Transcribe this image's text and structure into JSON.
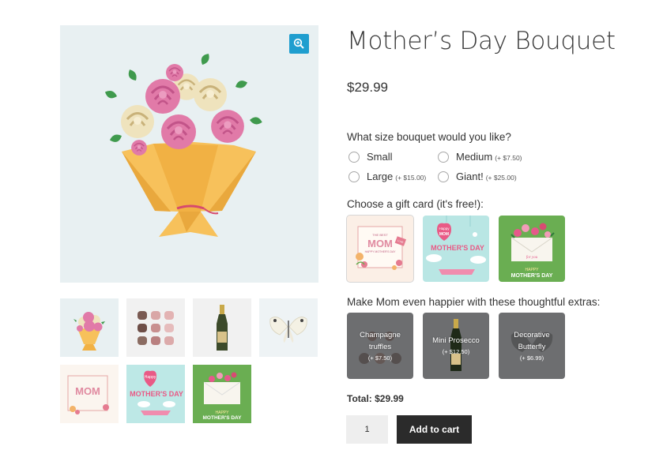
{
  "product": {
    "title": "Mother’s Day Bouquet",
    "price": "$29.99",
    "main_image_icon": "bouquet-illustration",
    "zoom_icon": "magnify-plus-icon"
  },
  "gallery": {
    "thumbnails": [
      {
        "name": "bouquet"
      },
      {
        "name": "chocolate-truffles"
      },
      {
        "name": "prosecco-bottle"
      },
      {
        "name": "butterfly"
      },
      {
        "name": "mom-card"
      },
      {
        "name": "happy-mothers-day-card"
      },
      {
        "name": "envelope-flowers-card"
      }
    ]
  },
  "size_question": {
    "label": "What size bouquet would you like?",
    "options": [
      {
        "label": "Small",
        "addon": ""
      },
      {
        "label": "Medium",
        "addon": "(+ $7.50)"
      },
      {
        "label": "Large",
        "addon": "(+ $15.00)"
      },
      {
        "label": "Giant!",
        "addon": "(+ $25.00)"
      }
    ]
  },
  "gift_card": {
    "label": "Choose a gift card (it's free!):",
    "card1_texts": {
      "small_top": "THE BEST",
      "big": "MOM",
      "small_bottom": "HAPPY MOTHER'S DAY",
      "tag": "LOVE"
    },
    "card2_texts": {
      "happy": "Happy",
      "mom": "MOM",
      "line": "MOTHER'S DAY"
    },
    "card3_texts": {
      "for_you": "for you",
      "line1": "HAPPY",
      "line2": "MOTHER'S DAY"
    }
  },
  "extras": {
    "label": "Make Mom even happier with these thoughtful extras:",
    "items": [
      {
        "name_line1": "Champagne",
        "name_line2": "truffles",
        "cost": "(+ $7.50)"
      },
      {
        "name_line1": "Mini Prosecco",
        "name_line2": "",
        "cost": "(+ $12.50)"
      },
      {
        "name_line1": "Decorative",
        "name_line2": "Butterfly",
        "cost": "(+ $6.99)"
      }
    ]
  },
  "cart": {
    "total_label": "Total: $29.99",
    "quantity": "1",
    "add_label": "Add to cart"
  },
  "colors": {
    "accent": "#1f9ecf",
    "button_dark": "#2b2b2b",
    "extra_tile": "#6d6e70"
  }
}
